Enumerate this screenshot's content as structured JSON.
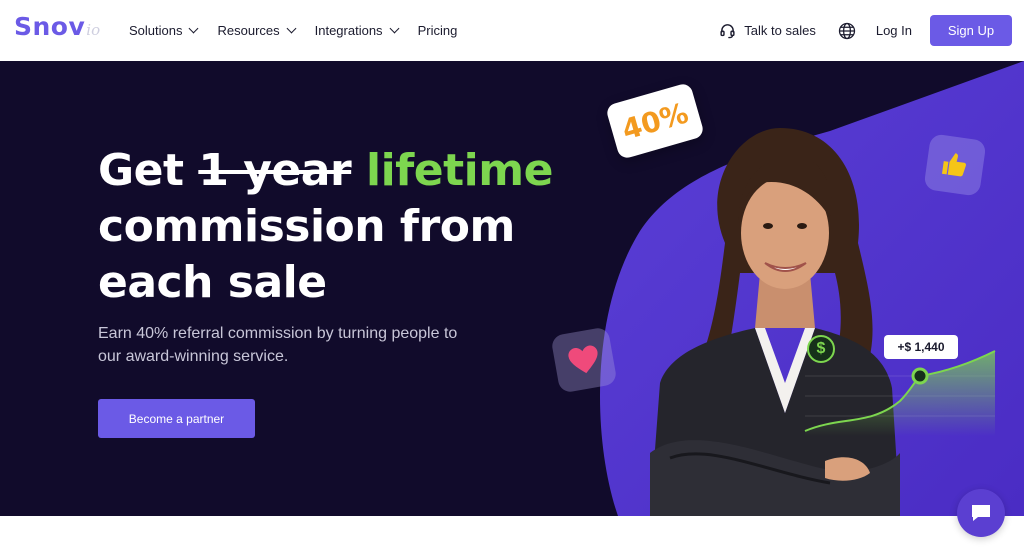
{
  "logo": {
    "main": "Snov",
    "sub": "io"
  },
  "nav": {
    "items": [
      {
        "label": "Solutions",
        "dropdown": true
      },
      {
        "label": "Resources",
        "dropdown": true
      },
      {
        "label": "Integrations",
        "dropdown": true
      },
      {
        "label": "Pricing",
        "dropdown": false
      }
    ],
    "talk_to_sales": "Talk to sales",
    "login": "Log In",
    "signup": "Sign Up"
  },
  "hero": {
    "headline_get": "Get ",
    "headline_strike": "1 year",
    "headline_space": " ",
    "headline_green": "lifetime",
    "headline_rest": "commission from each sale",
    "subtext": "Earn 40% referral commission by turning people to our award-winning service.",
    "cta": "Become a partner",
    "badge": "40%",
    "dollar_symbol": "$",
    "amount": "+$ 1,440"
  },
  "colors": {
    "brand": "#6b5ae6",
    "hero_bg": "#110b2b",
    "accent_green": "#7dd64f",
    "badge_orange": "#f39a1f"
  }
}
